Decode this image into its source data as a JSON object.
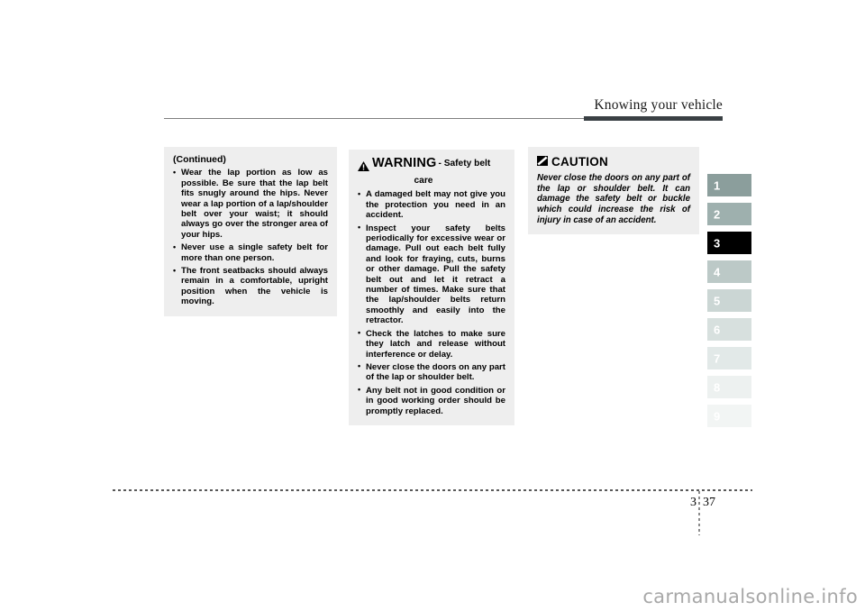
{
  "header": {
    "title": "Knowing your vehicle"
  },
  "continued_panel": {
    "title": "(Continued)",
    "bullets": [
      "Wear the lap portion as low as possible.  Be sure that the lap belt fits snugly around the hips.  Never wear a lap portion of a lap/shoulder belt over your waist; it should always go over the stronger area of your hips.",
      "Never use a single safety belt for more than one person.",
      "The front seatbacks should always remain in a comfortable, upright position when the vehicle is moving."
    ]
  },
  "warning_panel": {
    "icon": "warning-triangle-icon",
    "heading": "WARNING",
    "subheading_line1": "- Safety belt",
    "subheading_line2": "care",
    "bullets": [
      "A damaged belt may not give you the protection you need in an accident.",
      "Inspect your safety belts periodically for excessive wear or damage.  Pull out each belt fully and look for fraying, cuts, burns or other damage.  Pull the safety belt out and let it retract a number of times. Make sure that the lap/shoulder belts return smoothly and easily into the retractor.",
      "Check the latches to make sure they latch and release without interference or delay.",
      "Never close the doors on any part of the lap or shoulder belt.",
      "Any belt not in good condition or in good working order should be promptly replaced."
    ]
  },
  "caution_panel": {
    "icon": "caution-slash-icon",
    "heading": "CAUTION",
    "body": "Never close the doors on any part of the lap or shoulder belt. It can damage the safety belt or buckle which could increase the risk of injury in case of an accident."
  },
  "chapter_tabs": {
    "items": [
      {
        "label": "1",
        "bg": "#8b9e9c",
        "fg": "#ffffff",
        "active": false
      },
      {
        "label": "2",
        "bg": "#9eb0ae",
        "fg": "#ffffff",
        "active": false
      },
      {
        "label": "3",
        "bg": "#000000",
        "fg": "#ffffff",
        "active": true
      },
      {
        "label": "4",
        "bg": "#bcc9c7",
        "fg": "#ffffff",
        "active": false
      },
      {
        "label": "5",
        "bg": "#cbd6d4",
        "fg": "#ffffff",
        "active": false
      },
      {
        "label": "6",
        "bg": "#d7e0de",
        "fg": "#ffffff",
        "active": false
      },
      {
        "label": "7",
        "bg": "#e2e9e8",
        "fg": "#ffffff",
        "active": false
      },
      {
        "label": "8",
        "bg": "#edf1f0",
        "fg": "#ffffff",
        "active": false
      },
      {
        "label": "9",
        "bg": "#f2f5f4",
        "fg": "#ffffff",
        "active": false
      }
    ]
  },
  "footer": {
    "chapter": "3",
    "page": "37"
  },
  "watermark": {
    "text": "carmanualsonline.info"
  }
}
